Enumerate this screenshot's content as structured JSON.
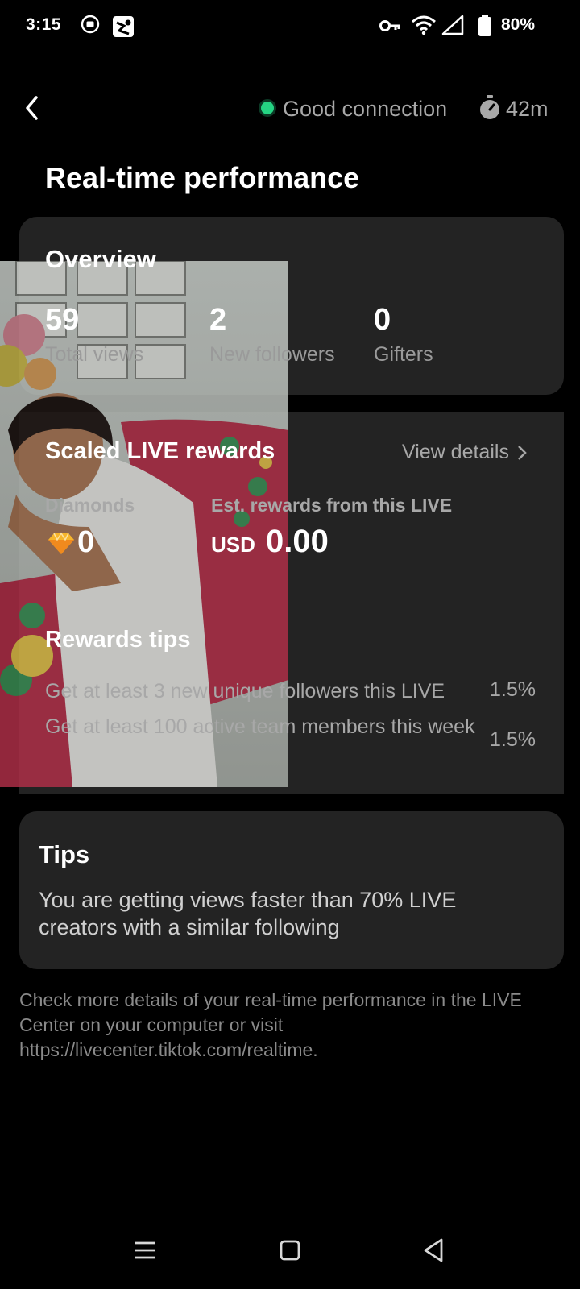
{
  "status_bar": {
    "time": "3:15",
    "battery": "80%",
    "icons": [
      "record-icon",
      "app-icon",
      "key-icon",
      "wifi-icon",
      "signal-icon",
      "battery-icon"
    ]
  },
  "header": {
    "connection": "Good connection",
    "connection_color": "#25d483",
    "duration": "42m"
  },
  "title": "Real-time performance",
  "overview": {
    "title": "Overview",
    "stats": [
      {
        "value": "59",
        "label": "Total views"
      },
      {
        "value": "2",
        "label": "New followers"
      },
      {
        "value": "0",
        "label": "Gifters"
      }
    ]
  },
  "rewards": {
    "title": "Scaled LIVE rewards",
    "view_details": "View details",
    "diamonds_label": "Diamonds",
    "diamonds_value": "0",
    "est_label": "Est. rewards from this LIVE",
    "currency": "USD",
    "est_value": "0.00",
    "tips_title": "Rewards tips",
    "tips": [
      {
        "text": "Get at least 3 new unique followers this LIVE",
        "pct": "1.5%"
      },
      {
        "text": "Get at least 100 active team members this week",
        "pct": "1.5%"
      }
    ]
  },
  "tips": {
    "title": "Tips",
    "body": "You are getting views faster than 70% LIVE creators with a similar following"
  },
  "footer": "Check more details of your real-time performance in the LIVE Center on your computer or visit https://livecenter.tiktok.com/realtime."
}
